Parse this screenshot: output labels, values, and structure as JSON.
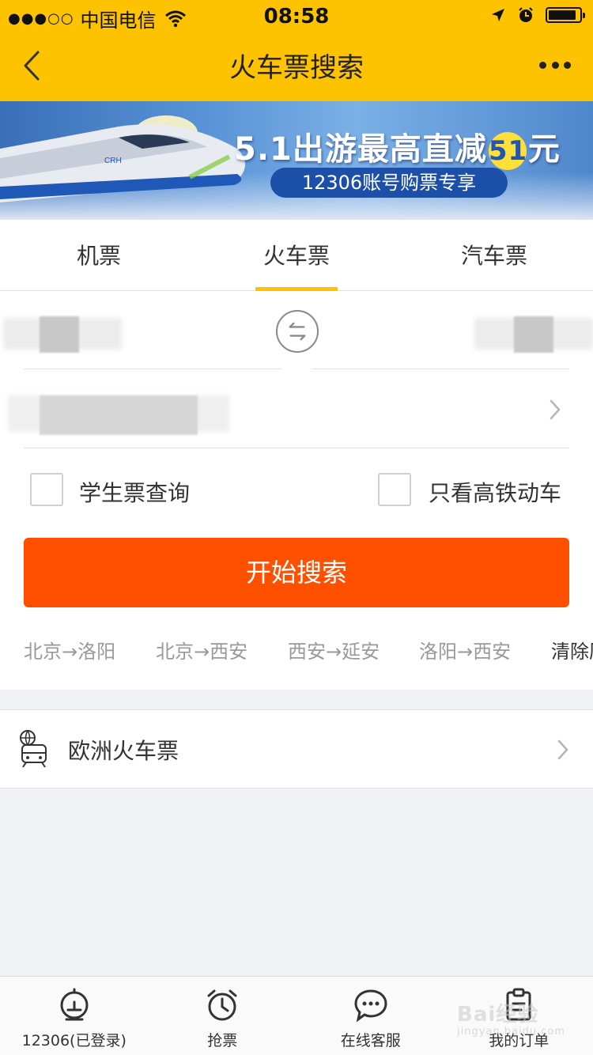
{
  "status_bar": {
    "signal": "●●●○○",
    "carrier": "中国电信",
    "time": "08:58"
  },
  "header": {
    "title": "火车票搜索"
  },
  "banner": {
    "headline_prefix": "5.1出游最高直减",
    "headline_number": "51",
    "headline_suffix": "元",
    "subtitle": "12306账号购票专享"
  },
  "tabs": [
    {
      "label": "机票",
      "active": false
    },
    {
      "label": "火车票",
      "active": true
    },
    {
      "label": "汽车票",
      "active": false
    }
  ],
  "form": {
    "student_label": "学生票查询",
    "gaotie_label": "只看高铁动车",
    "search_label": "开始搜索"
  },
  "history": [
    "北京→洛阳",
    "北京→西安",
    "西安→延安",
    "洛阳→西安"
  ],
  "history_clear": "清除历史",
  "europe": {
    "label": "欧洲火车票"
  },
  "tabbar": [
    {
      "label": "12306(已登录)",
      "icon": "station-icon"
    },
    {
      "label": "抢票",
      "icon": "alarm-clock-icon"
    },
    {
      "label": "在线客服",
      "icon": "chat-bubble-icon"
    },
    {
      "label": "我的订单",
      "icon": "clipboard-icon"
    }
  ],
  "watermark": {
    "text": "Bai经验",
    "sub": "jingyan.baidu.com"
  },
  "colors": {
    "header_yellow": "#fdc200",
    "search_orange": "#ff5000",
    "tab_indicator": "#fdc200"
  }
}
